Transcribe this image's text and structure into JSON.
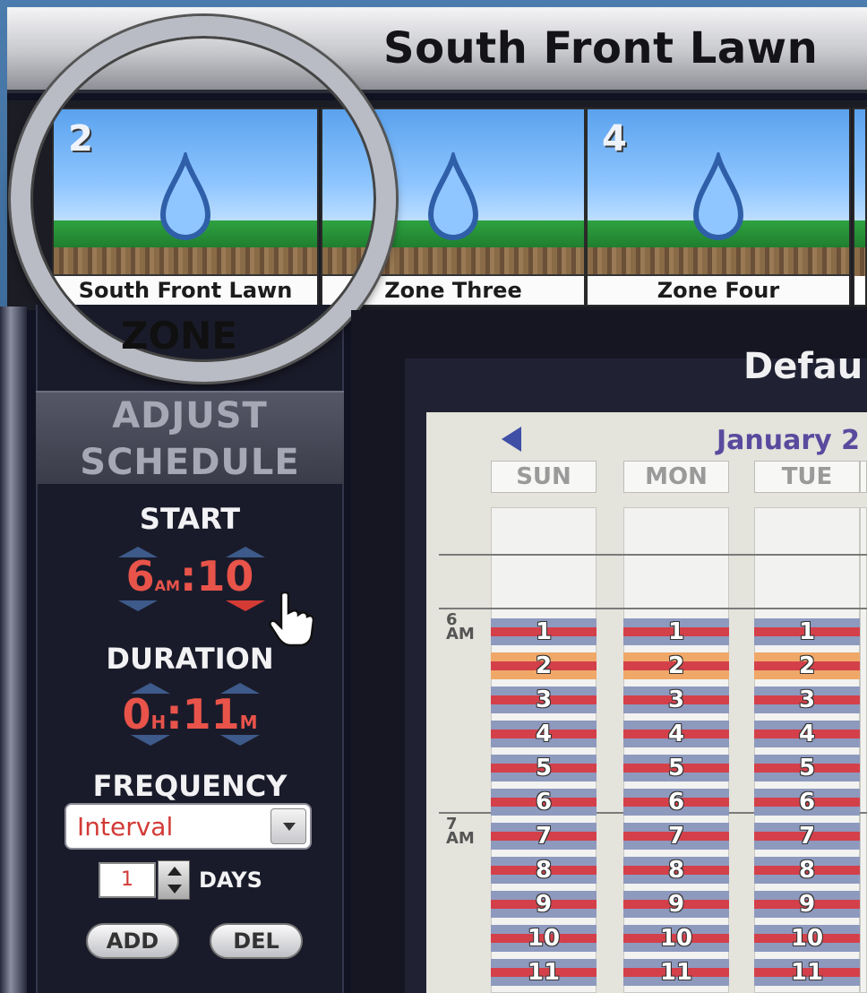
{
  "window": {
    "title": "South Front Lawn"
  },
  "zones": [
    {
      "number": "2",
      "name": "South Front Lawn"
    },
    {
      "number": "",
      "name": "Zone Three"
    },
    {
      "number": "4",
      "name": "Zone Four"
    }
  ],
  "left_panel": {
    "zone_label": "ZONE",
    "adjust_line1": "ADJUST",
    "adjust_line2": "SCHEDULE",
    "start_label": "START",
    "start_hour": "6",
    "start_ampm": "AM",
    "start_minute": "10",
    "duration_label": "DURATION",
    "duration_hours": "0",
    "duration_h_unit": "H",
    "duration_minutes": "11",
    "duration_m_unit": "M",
    "frequency_label": "FREQUENCY",
    "frequency_value": "Interval",
    "interval_days": "1",
    "days_label": "DAYS",
    "add_label": "ADD",
    "del_label": "DEL"
  },
  "schedule": {
    "title": "Defau",
    "month_label": "January 2",
    "days": [
      "SUN",
      "MON",
      "TUE"
    ],
    "hour_labels": [
      {
        "hour": "6",
        "ampm": "AM"
      },
      {
        "hour": "7",
        "ampm": "AM"
      }
    ],
    "slots": [
      "1",
      "2",
      "3",
      "4",
      "5",
      "6",
      "7",
      "8",
      "9",
      "10",
      "11"
    ],
    "highlighted_slot": "2"
  },
  "colors": {
    "accent_red": "#e8534a",
    "slot_blue": "#8e99be",
    "slot_red": "#d4404a",
    "slot_highlight": "#f0a868",
    "header_purple": "#5a4a9e"
  }
}
